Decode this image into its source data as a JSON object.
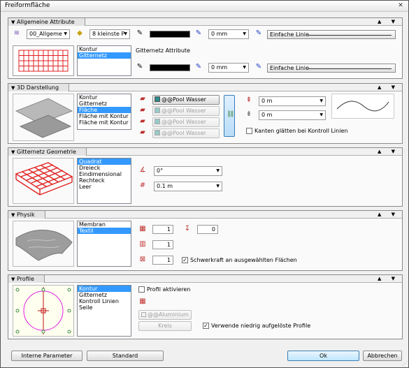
{
  "window": {
    "title": "Freiformfläche",
    "close_glyph": "✕"
  },
  "section_arrows": "▲ ▼",
  "allgemeine": {
    "title": "Allgemeine Attribute",
    "layer": "00_Allgeme",
    "pen": "8 kleinste P",
    "pen_offset_1": "0 mm",
    "pen_offset_2": "0 mm",
    "line_type_1": "Einfache Linie",
    "line_type_2": "Einfache Linie",
    "list": [
      "Kontur",
      "Gitternetz"
    ],
    "selected_index": 1,
    "grid_attr_label": "Gitternetz Attribute"
  },
  "darstellung": {
    "title": "3D Darstellung",
    "list": [
      "Kontur",
      "Gitternetz",
      "Fläche",
      "Fläche mit Kontur",
      "Fläche mit Kontur und"
    ],
    "selected_index": 2,
    "materials": [
      "@@Pool Wasser",
      "@@Pool Wasser",
      "@@Pool Wasser",
      "@@Pool Wasser"
    ],
    "height_1": "0 m",
    "height_2": "0 m",
    "smooth_label": "Kanten glätten bei Kontroll Linien"
  },
  "geometrie": {
    "title": "Gitternetz Geometrie",
    "list": [
      "Quadrat",
      "Dreieck",
      "Eindimensional",
      "Rechteck",
      "Leer"
    ],
    "selected_index": 0,
    "angle": "0°",
    "spacing": "0.1 m"
  },
  "physik": {
    "title": "Physik",
    "list": [
      "Membran",
      "Textil"
    ],
    "selected_index": 1,
    "value_1": "1",
    "value_2": "0",
    "value_3": "1",
    "value_4": "1",
    "gravity_label": "Schwerkraft an ausgewählten Flächen",
    "gravity_checked": true
  },
  "profile": {
    "title": "Profile",
    "list": [
      "Kontur",
      "Gitternetz",
      "Kontroll Linien",
      "Seile"
    ],
    "selected_index": 0,
    "activate_label": "Profil aktivieren",
    "material": "@@Aluminium",
    "shape": "Kreis",
    "lowres_label": "Verwende niedrig aufgelöste Profile",
    "lowres_checked": true
  },
  "buttons": {
    "interne": "Interne Parameter",
    "standard": "Standard",
    "ok": "Ok",
    "abbrechen": "Abbrechen"
  },
  "colors": {
    "selection": "#3399ff",
    "grid_red": "#e02020",
    "profile_magenta": "#e020e0"
  }
}
